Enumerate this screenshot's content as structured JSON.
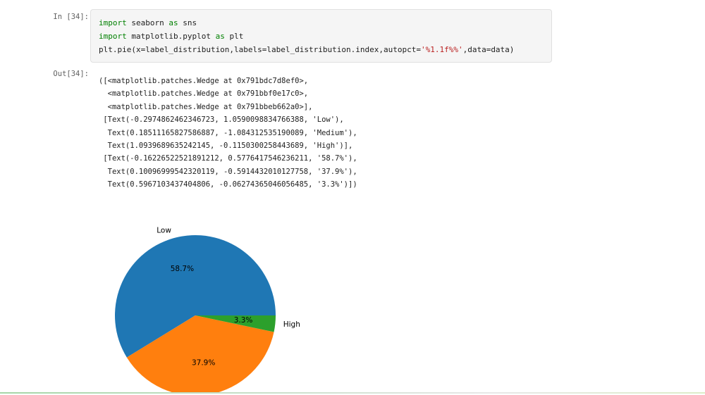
{
  "cell": {
    "in_prompt": "In [34]:",
    "out_prompt": "Out[34]:",
    "code": {
      "line1": {
        "kw1": "import",
        "mod": " seaborn ",
        "kw2": "as",
        "alias": " sns"
      },
      "line2": {
        "kw1": "import",
        "mod": " matplotlib.pyplot ",
        "kw2": "as",
        "alias": " plt"
      },
      "line3": {
        "pre": "plt.pie(x=label_distribution,labels=label_distribution.index,autopct=",
        "str": "'%1.1f%%'",
        "post": ",data=data)"
      }
    },
    "output_lines": [
      "([<matplotlib.patches.Wedge at 0x791bdc7d8ef0>,",
      "  <matplotlib.patches.Wedge at 0x791bbf0e17c0>,",
      "  <matplotlib.patches.Wedge at 0x791bbeb662a0>],",
      " [Text(-0.2974862462346723, 1.0590098834766388, 'Low'),",
      "  Text(0.18511165827586887, -1.084312535190089, 'Medium'),",
      "  Text(1.0939689635242145, -0.1150300258443689, 'High')],",
      " [Text(-0.16226522521891212, 0.5776417546236211, '58.7%'),",
      "  Text(0.10096999542320119, -0.5914432010127758, '37.9%'),",
      "  Text(0.5967103437404806, -0.06274365046056485, '3.3%')])"
    ]
  },
  "chart_data": {
    "type": "pie",
    "categories": [
      "Low",
      "Medium",
      "High"
    ],
    "values": [
      58.7,
      37.9,
      3.3
    ],
    "autopct_labels": [
      "58.7%",
      "37.9%",
      "3.3%"
    ],
    "colors": [
      "#1f77b4",
      "#ff7f0e",
      "#2ca02c"
    ],
    "start_angle_deg": 0,
    "direction": "counterclockwise",
    "title": ""
  }
}
